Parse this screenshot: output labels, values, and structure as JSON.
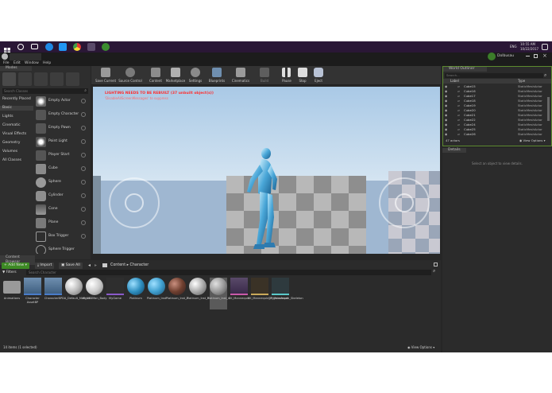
{
  "taskbar": {
    "tray_lang": "ENG",
    "clock_time": "10:55 AM",
    "clock_date": "10/22/2017"
  },
  "window": {
    "user": "Dolbusau"
  },
  "menubar": {
    "items": [
      "File",
      "Edit",
      "Window",
      "Help"
    ]
  },
  "modes_panel": {
    "tab": "Modes",
    "search_placeholder": "Search Classes",
    "categories": [
      "Recently Placed",
      "Basic",
      "Lights",
      "Cinematic",
      "Visual Effects",
      "Geometry",
      "Volumes",
      "All Classes"
    ],
    "items": [
      "Empty Actor",
      "Empty Character",
      "Empty Pawn",
      "Point Light",
      "Player Start",
      "Cube",
      "Sphere",
      "Cylinder",
      "Cone",
      "Plane",
      "Box Trigger",
      "Sphere Trigger"
    ]
  },
  "toolbar": {
    "items": [
      "Save Current",
      "Source Control",
      "Content",
      "Marketplace",
      "Settings",
      "Blueprints",
      "Cinematics",
      "Build",
      "Pause",
      "Stop",
      "Eject"
    ]
  },
  "viewport": {
    "warning": "LIGHTING NEEDS TO BE REBUILT (37 unbuilt object(s))",
    "warning_sub": "'DisableAllScreenMessages' to suppress"
  },
  "world_outliner": {
    "tab": "World Outliner",
    "search_placeholder": "Search...",
    "col_label": "Label",
    "col_type": "Type",
    "rows": [
      {
        "label": "Cube15",
        "type": "StaticMeshActor"
      },
      {
        "label": "Cube16",
        "type": "StaticMeshActor"
      },
      {
        "label": "Cube17",
        "type": "StaticMeshActor"
      },
      {
        "label": "Cube18",
        "type": "StaticMeshActor"
      },
      {
        "label": "Cube19",
        "type": "StaticMeshActor"
      },
      {
        "label": "Cube20",
        "type": "StaticMeshActor"
      },
      {
        "label": "Cube21",
        "type": "StaticMeshActor"
      },
      {
        "label": "Cube22",
        "type": "StaticMeshActor"
      },
      {
        "label": "Cube24",
        "type": "StaticMeshActor"
      },
      {
        "label": "Cube25",
        "type": "StaticMeshActor"
      },
      {
        "label": "Cube26",
        "type": "StaticMeshActor"
      }
    ],
    "actor_count": "47 actors",
    "view_options": "View Options"
  },
  "details": {
    "tab": "Details",
    "empty_text": "Select an object to view details."
  },
  "content_browser": {
    "tab": "Content Browser",
    "add_new": "Add New",
    "import": "Import",
    "save_all": "Save All",
    "path": [
      "Content",
      "Character"
    ],
    "filters": "Filters",
    "search_placeholder": "Search Character",
    "assets": [
      "Animations",
      "Character AssetBP",
      "CharacterBP",
      "DA_Default_Material",
      "M_UE4Man_Body",
      "MyGame",
      "Platinum",
      "Platinum_Inst",
      "Platinum_Inst_2",
      "Platinum_Inst_3",
      "Platinum_Inst_4",
      "SK_Mannequin",
      "SK_Mannequin_PhysicsAsset",
      "SK_Mannequin_Skeleton"
    ],
    "status": "14 items (1 selected)",
    "view_options": "View Options"
  }
}
